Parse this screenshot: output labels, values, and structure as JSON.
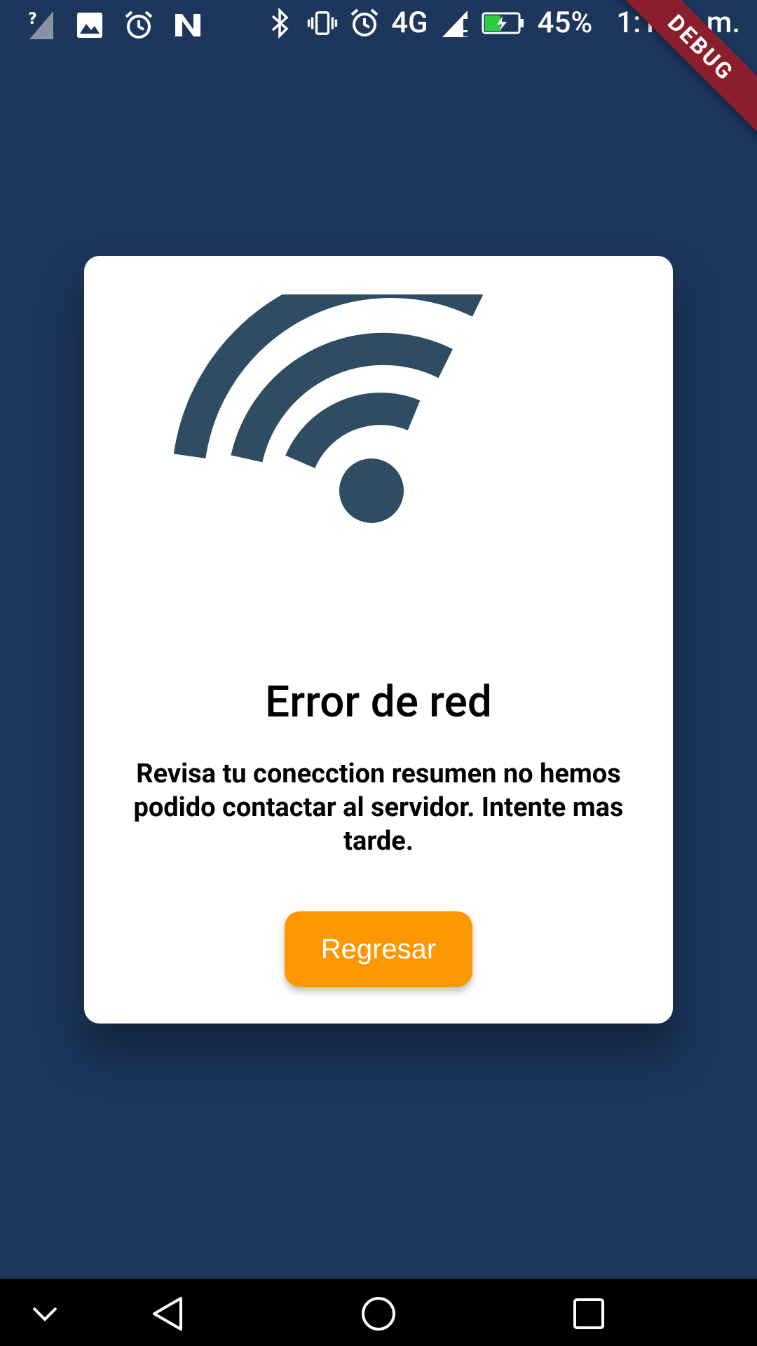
{
  "status_bar": {
    "battery_percent": "45%",
    "time": "1:11 p.m.",
    "network_type": "4G",
    "icons_left": [
      "signal-unknown-icon",
      "image-icon",
      "alarm-icon",
      "n-app-icon"
    ],
    "icons_right": [
      "bluetooth-icon",
      "vibrate-icon",
      "alarm-icon",
      "signal-4g-icon",
      "battery-charging-icon"
    ]
  },
  "debug_banner": {
    "label": "DEBUG"
  },
  "dialog": {
    "icon": "wifi-icon",
    "title": "Error de red",
    "message": "Revisa tu conecction resumen no hemos podido contactar al servidor. Intente mas tarde.",
    "button_label": "Regresar"
  },
  "nav_bar": {
    "buttons": [
      "collapse-icon",
      "back-icon",
      "home-icon",
      "recents-icon"
    ]
  },
  "colors": {
    "background": "#1c365c",
    "card": "#ffffff",
    "accent": "#ff9800",
    "wifi_icon": "#2e4d63",
    "debug_ribbon": "#8b1e2d"
  }
}
